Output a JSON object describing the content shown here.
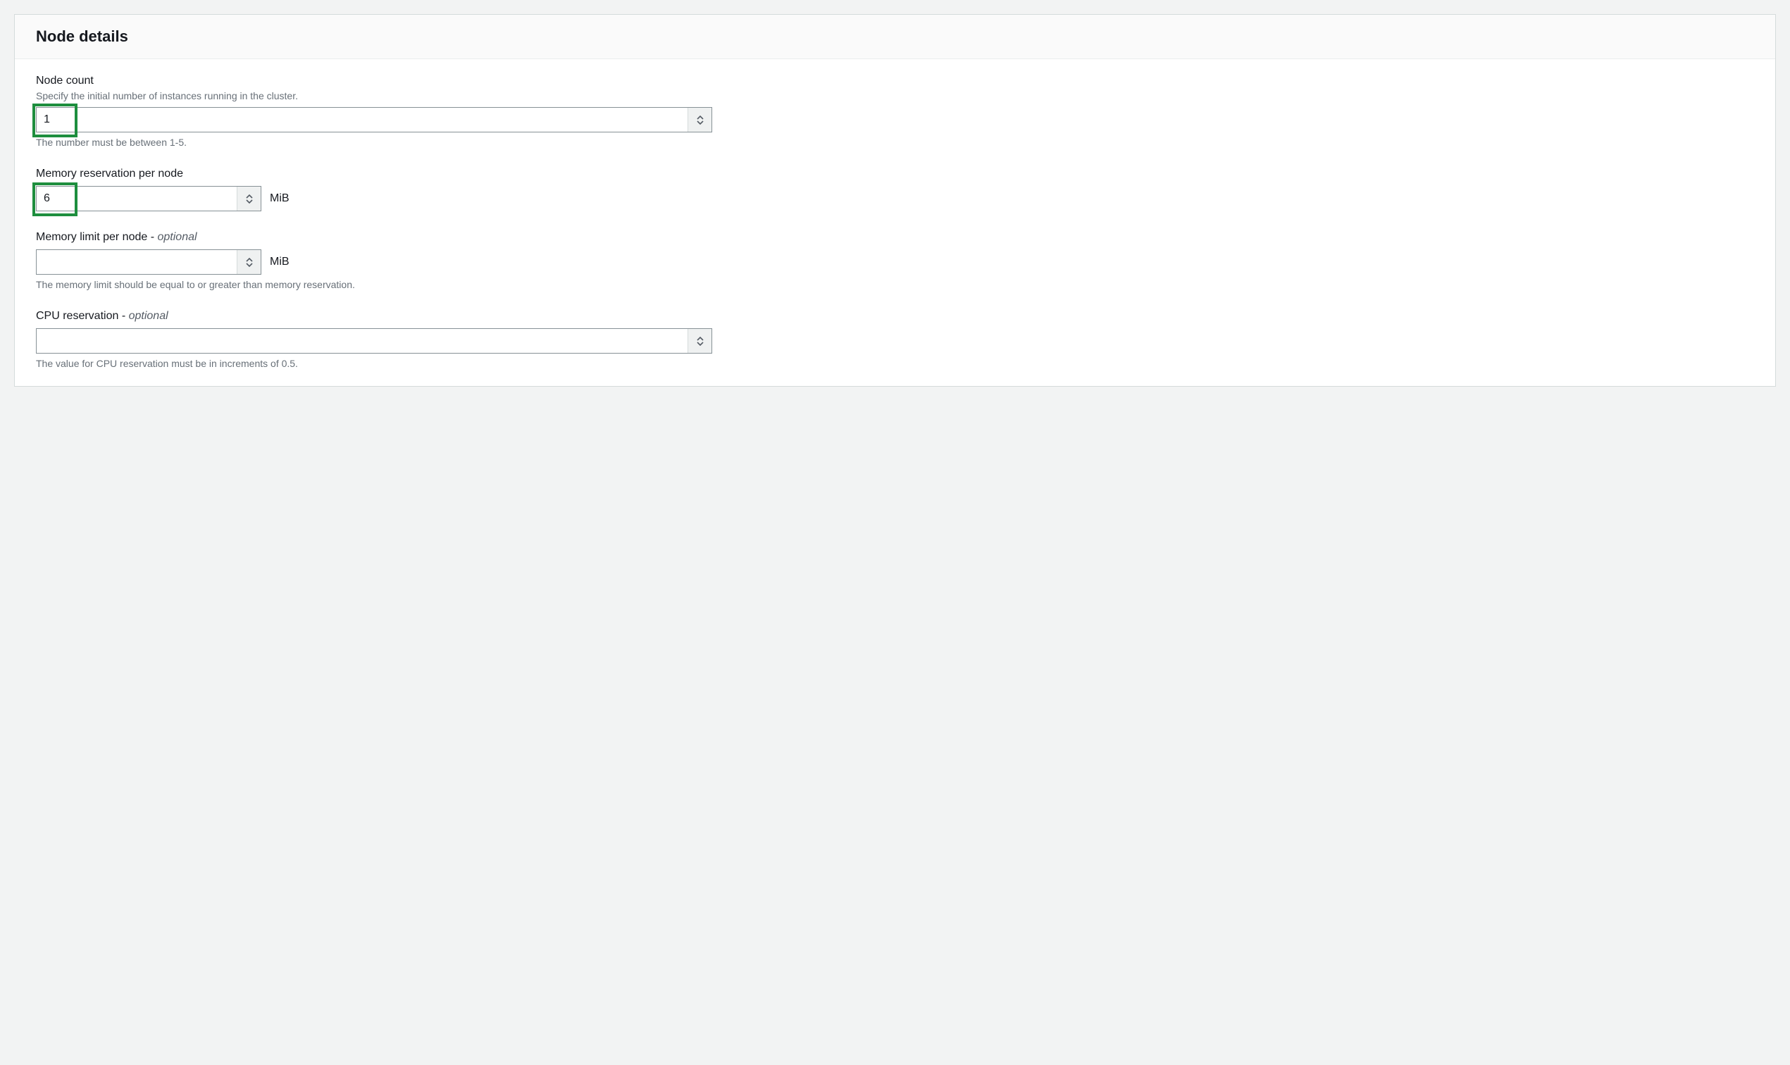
{
  "panel": {
    "title": "Node details"
  },
  "nodeCount": {
    "label": "Node count",
    "description": "Specify the initial number of instances running in the cluster.",
    "value": "1",
    "constraint": "The number must be between 1-5."
  },
  "memReservation": {
    "label": "Memory reservation per node",
    "value": "6",
    "unit": "MiB"
  },
  "memLimit": {
    "labelMain": "Memory limit per node - ",
    "labelOptional": "optional",
    "value": "",
    "unit": "MiB",
    "constraint": "The memory limit should be equal to or greater than memory reservation."
  },
  "cpuReservation": {
    "labelMain": "CPU reservation - ",
    "labelOptional": "optional",
    "value": "",
    "constraint": "The value for CPU reservation must be in increments of 0.5."
  }
}
